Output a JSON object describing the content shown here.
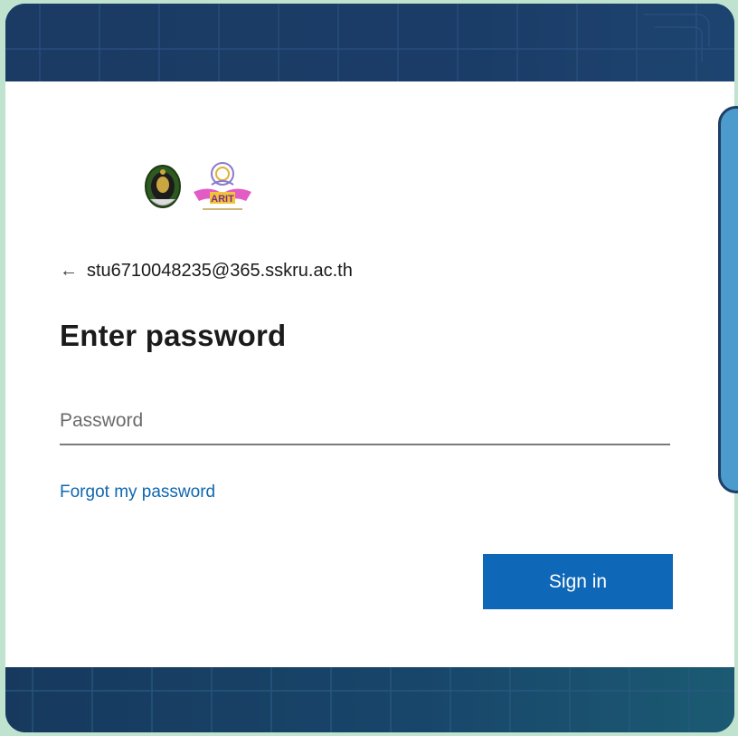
{
  "colors": {
    "page_bg": "#bfe3cf",
    "header_band": "#1b3b64",
    "footer_band": "#18456a",
    "side_panel": "#4b9bcc",
    "link": "#0f67b0",
    "button_bg": "#0f67b8",
    "button_text": "#ffffff"
  },
  "logos": {
    "left_icon": "university-seal-icon",
    "right_icon": "arit-emblem-icon",
    "right_caption": "ARIT"
  },
  "account": {
    "back_icon": "back-arrow-icon",
    "back_glyph": "←",
    "email": "stu6710048235@365.sskru.ac.th"
  },
  "form": {
    "title": "Enter password",
    "password_placeholder": "Password",
    "forgot_link": "Forgot my password",
    "submit_label": "Sign in"
  }
}
